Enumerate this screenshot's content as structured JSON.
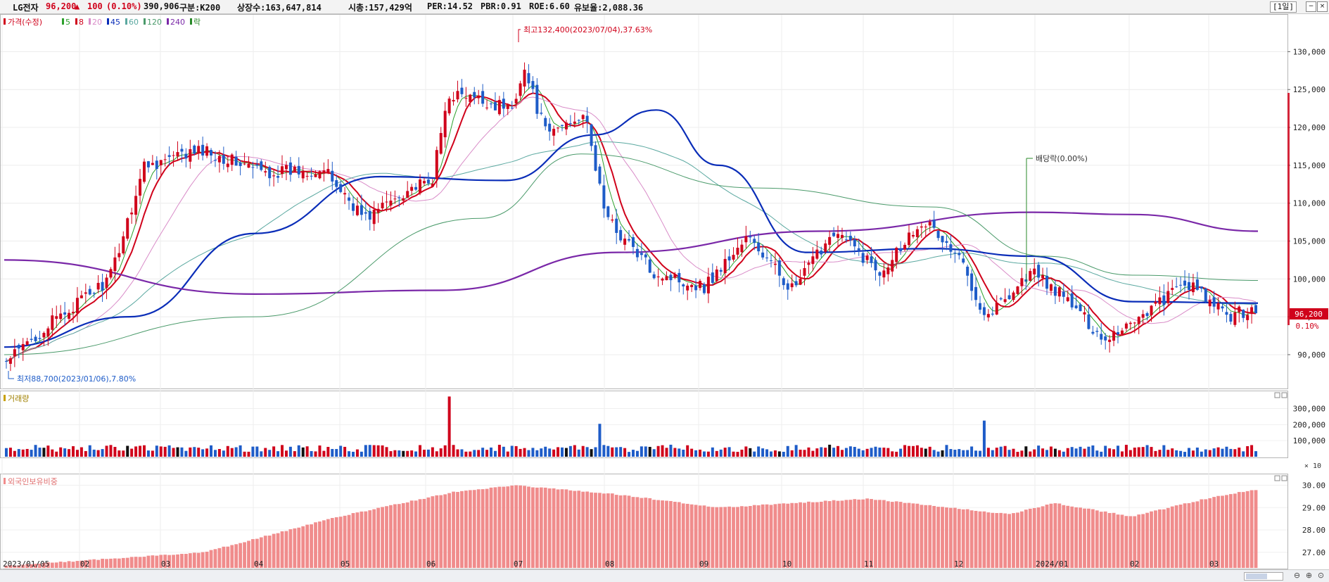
{
  "header": {
    "stock_name": "LG전자",
    "price": "96,200",
    "change_arrow": "▲",
    "change": "100",
    "change_pct": "(0.10%)",
    "volume": "390,906",
    "category": "구분:K200",
    "shares": "상장수:163,647,814",
    "market_cap": "시총:157,429억",
    "per": "PER:14.52",
    "pbr": "PBR:0.91",
    "roe": "ROE:6.60",
    "float_ratio": "유보율:2,088.36",
    "period": "[1일]"
  },
  "legend": {
    "price_label": "가격(수정)",
    "ma": [
      {
        "period": "5",
        "color": "#2ca02c"
      },
      {
        "period": "8",
        "color": "#d0021b"
      },
      {
        "period": "20",
        "color": "#d98cc8"
      },
      {
        "period": "45",
        "color": "#0a2db8"
      },
      {
        "period": "60",
        "color": "#5aa8a0"
      },
      {
        "period": "120",
        "color": "#4a9a6a"
      },
      {
        "period": "240",
        "color": "#7a28a8"
      }
    ],
    "dividend_flag": "락"
  },
  "annotations": {
    "high": "최고132,400(2023/07/04),37.63%",
    "low": "최저88,700(2023/01/06),7.80%",
    "dividend": "배당락(0.00%)",
    "current_price": "96,200",
    "current_pct": "0.10%"
  },
  "volume_panel": {
    "title": "거래량",
    "unit": "× 10"
  },
  "foreign_panel": {
    "title": "외국인보유비중"
  },
  "colors": {
    "up": "#d0021b",
    "down": "#1e5cc8",
    "neutral": "#111111",
    "foreign": "#f08c8c"
  },
  "chart_data": [
    {
      "type": "candlestick",
      "title": "LG전자",
      "price_axis_ticks": [
        90000,
        95000,
        100000,
        105000,
        110000,
        115000,
        120000,
        125000,
        130000
      ],
      "price_axis_labels": [
        "90,000",
        "95,000",
        "100,000",
        "105,000",
        "110,000",
        "115,000",
        "120,000",
        "125,000",
        "130,000"
      ],
      "ylim": [
        86000,
        134500
      ],
      "x_labels": [
        "2023/01/05",
        "02",
        "03",
        "04",
        "05",
        "06",
        "07",
        "08",
        "09",
        "10",
        "11",
        "12",
        "2024/01",
        "02",
        "03"
      ],
      "approx_close_path": [
        {
          "date": "2023/01/05",
          "close": 89000
        },
        {
          "date": "2023/01/20",
          "close": 94000
        },
        {
          "date": "2023/02/10",
          "close": 100000
        },
        {
          "date": "2023/02/22",
          "close": 115000
        },
        {
          "date": "2023/03/15",
          "close": 117000
        },
        {
          "date": "2023/04/05",
          "close": 114000
        },
        {
          "date": "2023/04/25",
          "close": 114500
        },
        {
          "date": "2023/05/10",
          "close": 108000
        },
        {
          "date": "2023/05/25",
          "close": 112000
        },
        {
          "date": "2023/06/02",
          "close": 112500
        },
        {
          "date": "2023/06/08",
          "close": 124500
        },
        {
          "date": "2023/06/30",
          "close": 122500
        },
        {
          "date": "2023/07/04",
          "close": 128000
        },
        {
          "date": "2023/07/12",
          "close": 119000
        },
        {
          "date": "2023/07/25",
          "close": 122000
        },
        {
          "date": "2023/08/02",
          "close": 108000
        },
        {
          "date": "2023/08/18",
          "close": 101000
        },
        {
          "date": "2023/09/05",
          "close": 99000
        },
        {
          "date": "2023/09/20",
          "close": 105500
        },
        {
          "date": "2023/10/06",
          "close": 98500
        },
        {
          "date": "2023/10/20",
          "close": 106500
        },
        {
          "date": "2023/11/05",
          "close": 101000
        },
        {
          "date": "2023/11/20",
          "close": 108000
        },
        {
          "date": "2023/12/04",
          "close": 102000
        },
        {
          "date": "2023/12/12",
          "close": 95000
        },
        {
          "date": "2023/12/28",
          "close": 101000
        },
        {
          "date": "2024/01/10",
          "close": 97000
        },
        {
          "date": "2024/01/22",
          "close": 92000
        },
        {
          "date": "2024/02/05",
          "close": 95500
        },
        {
          "date": "2024/02/20",
          "close": 99500
        },
        {
          "date": "2024/03/05",
          "close": 95000
        },
        {
          "date": "2024/03/15",
          "close": 96200
        }
      ],
      "moving_averages": [
        {
          "name": "45",
          "points": [
            [
              0,
              91000
            ],
            [
              0.1,
              95000
            ],
            [
              0.2,
              106000
            ],
            [
              0.3,
              113500
            ],
            [
              0.4,
              113000
            ],
            [
              0.47,
              119000
            ],
            [
              0.52,
              122300
            ],
            [
              0.57,
              115000
            ],
            [
              0.64,
              103500
            ],
            [
              0.74,
              104000
            ],
            [
              0.82,
              103000
            ],
            [
              0.9,
              97000
            ],
            [
              1,
              96800
            ]
          ]
        },
        {
          "name": "240",
          "points": [
            [
              0,
              102500
            ],
            [
              0.2,
              98000
            ],
            [
              0.35,
              98500
            ],
            [
              0.49,
              103500
            ],
            [
              0.65,
              106300
            ],
            [
              0.82,
              108800
            ],
            [
              0.9,
              108500
            ],
            [
              1,
              106300
            ]
          ]
        },
        {
          "name": "120",
          "points": [
            [
              0,
              90000
            ],
            [
              0.2,
              95000
            ],
            [
              0.38,
              108000
            ],
            [
              0.46,
              116500
            ],
            [
              0.6,
              112000
            ],
            [
              0.74,
              109500
            ],
            [
              0.83,
              103000
            ],
            [
              0.9,
              100500
            ],
            [
              1,
              99800
            ]
          ]
        }
      ]
    },
    {
      "type": "bar",
      "title": "거래량",
      "y_axis_labels": [
        "100,000",
        "200,000",
        "300,000"
      ],
      "y_ticks": [
        100000,
        200000,
        300000
      ],
      "ylim": [
        0,
        390000
      ],
      "peaks": [
        {
          "date": "2023/06/08",
          "value": 375000
        },
        {
          "date": "2023/12/12",
          "value": 225000
        },
        {
          "date": "2023/07/31",
          "value": 205000
        }
      ],
      "typical_value": 50000
    },
    {
      "type": "bar",
      "title": "외국인보유비중",
      "y_axis_labels": [
        "27.00",
        "28.00",
        "29.00",
        "30.00"
      ],
      "y_ticks": [
        27.0,
        28.0,
        29.0,
        30.0
      ],
      "ylim": [
        26.3,
        30.3
      ],
      "approx_path": [
        {
          "date": "2023/01/05",
          "value": 26.4
        },
        {
          "date": "2023/03/15",
          "value": 27.0
        },
        {
          "date": "2023/05/01",
          "value": 28.6
        },
        {
          "date": "2023/06/10",
          "value": 29.7
        },
        {
          "date": "2023/07/01",
          "value": 30.0
        },
        {
          "date": "2023/08/05",
          "value": 29.6
        },
        {
          "date": "2023/09/10",
          "value": 29.0
        },
        {
          "date": "2023/11/01",
          "value": 29.4
        },
        {
          "date": "2023/12/20",
          "value": 28.7
        },
        {
          "date": "2024/01/05",
          "value": 29.2
        },
        {
          "date": "2024/02/01",
          "value": 28.6
        },
        {
          "date": "2024/03/01",
          "value": 29.5
        },
        {
          "date": "2024/03/15",
          "value": 29.8
        }
      ]
    }
  ]
}
